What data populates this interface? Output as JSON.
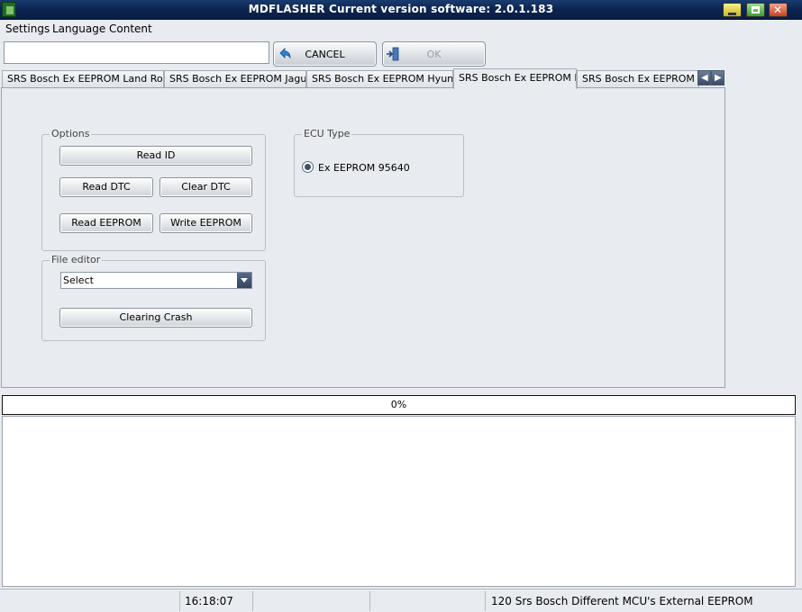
{
  "window": {
    "title": "MDFLASHER  Current version software: 2.0.1.183"
  },
  "menu": [
    "Settings",
    "Language",
    "Content"
  ],
  "toolbar": {
    "search_value": "",
    "cancel_label": "CANCEL",
    "ok_label": "OK"
  },
  "tabs": [
    {
      "label": "SRS Bosch Ex EEPROM Land Rover",
      "active": false
    },
    {
      "label": "SRS Bosch Ex EEPROM Jaguar",
      "active": false
    },
    {
      "label": "SRS Bosch Ex EEPROM Hyundai",
      "active": false
    },
    {
      "label": "SRS Bosch Ex EEPROM MB",
      "active": true
    },
    {
      "label": "SRS Bosch Ex EEPROM Dodge",
      "active": false
    }
  ],
  "options": {
    "legend": "Options",
    "read_id": "Read ID",
    "read_dtc": "Read DTC",
    "clear_dtc": "Clear DTC",
    "read_eeprom": "Read EEPROM",
    "write_eeprom": "Write EEPROM"
  },
  "ecu": {
    "legend": "ECU Type",
    "option": "Ex EEPROM 95640",
    "selected": true
  },
  "file_editor": {
    "legend": "File editor",
    "select_value": "Select",
    "clearing_crash": "Clearing Crash"
  },
  "progress": {
    "value": 0,
    "label": "0%"
  },
  "status": {
    "time": "16:18:07",
    "message": "120 Srs Bosch Different MCU's External EEPROM"
  }
}
